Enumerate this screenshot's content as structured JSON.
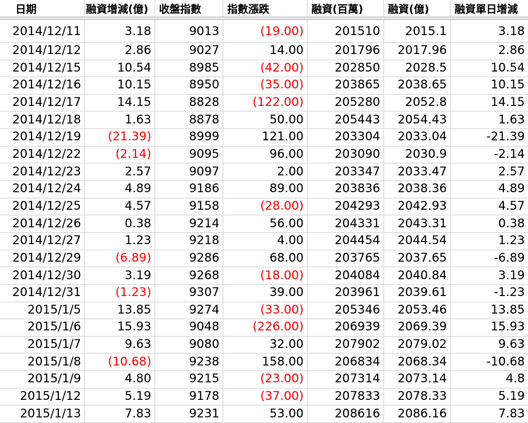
{
  "columns": [
    "日期",
    "融資增減(億)",
    "收盤指數",
    "指數漲跌",
    "融資(百萬)",
    "融資(億)",
    "融資單日增減"
  ],
  "rows": [
    [
      "2014/12/11",
      "3.18",
      "9013",
      "(19.00)",
      "201510",
      "2015.1",
      "3.18"
    ],
    [
      "2014/12/12",
      "2.86",
      "9027",
      "14.00",
      "201796",
      "2017.96",
      "2.86"
    ],
    [
      "2014/12/15",
      "10.54",
      "8985",
      "(42.00)",
      "202850",
      "2028.5",
      "10.54"
    ],
    [
      "2014/12/16",
      "10.15",
      "8950",
      "(35.00)",
      "203865",
      "2038.65",
      "10.15"
    ],
    [
      "2014/12/17",
      "14.15",
      "8828",
      "(122.00)",
      "205280",
      "2052.8",
      "14.15"
    ],
    [
      "2014/12/18",
      "1.63",
      "8878",
      "50.00",
      "205443",
      "2054.43",
      "1.63"
    ],
    [
      "2014/12/19",
      "(21.39)",
      "8999",
      "121.00",
      "203304",
      "2033.04",
      "-21.39"
    ],
    [
      "2014/12/22",
      "(2.14)",
      "9095",
      "96.00",
      "203090",
      "2030.9",
      "-2.14"
    ],
    [
      "2014/12/23",
      "2.57",
      "9097",
      "2.00",
      "203347",
      "2033.47",
      "2.57"
    ],
    [
      "2014/12/24",
      "4.89",
      "9186",
      "89.00",
      "203836",
      "2038.36",
      "4.89"
    ],
    [
      "2014/12/25",
      "4.57",
      "9158",
      "(28.00)",
      "204293",
      "2042.93",
      "4.57"
    ],
    [
      "2014/12/26",
      "0.38",
      "9214",
      "56.00",
      "204331",
      "2043.31",
      "0.38"
    ],
    [
      "2014/12/27",
      "1.23",
      "9218",
      "4.00",
      "204454",
      "2044.54",
      "1.23"
    ],
    [
      "2014/12/29",
      "(6.89)",
      "9286",
      "68.00",
      "203765",
      "2037.65",
      "-6.89"
    ],
    [
      "2014/12/30",
      "3.19",
      "9268",
      "(18.00)",
      "204084",
      "2040.84",
      "3.19"
    ],
    [
      "2014/12/31",
      "(1.23)",
      "9307",
      "39.00",
      "203961",
      "2039.61",
      "-1.23"
    ],
    [
      "2015/1/5",
      "13.85",
      "9274",
      "(33.00)",
      "205346",
      "2053.46",
      "13.85"
    ],
    [
      "2015/1/6",
      "15.93",
      "9048",
      "(226.00)",
      "206939",
      "2069.39",
      "15.93"
    ],
    [
      "2015/1/7",
      "9.63",
      "9080",
      "32.00",
      "207902",
      "2079.02",
      "9.63"
    ],
    [
      "2015/1/8",
      "(10.68)",
      "9238",
      "158.00",
      "206834",
      "2068.34",
      "-10.68"
    ],
    [
      "2015/1/9",
      "4.80",
      "9215",
      "(23.00)",
      "207314",
      "2073.14",
      "4.8"
    ],
    [
      "2015/1/12",
      "5.19",
      "9178",
      "(37.00)",
      "207833",
      "2078.33",
      "5.19"
    ],
    [
      "2015/1/13",
      "7.83",
      "9231",
      "53.00",
      "208616",
      "2086.16",
      "7.83"
    ]
  ],
  "negative_color": "#ff0000"
}
